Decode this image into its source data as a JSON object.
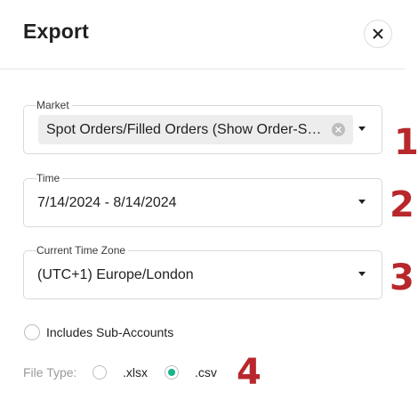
{
  "dialog": {
    "title": "Export",
    "close_icon": "close-icon"
  },
  "market": {
    "label": "Market",
    "selected_chip": "Spot Orders/Filled Orders (Show Order-Specific Details)",
    "chip_display": "Spot Orders/Filled Orders (Show Order-Sp...",
    "marker": "1"
  },
  "time": {
    "label": "Time",
    "value": "7/14/2024 - 8/14/2024",
    "marker": "2"
  },
  "timezone": {
    "label": "Current Time Zone",
    "value": "(UTC+1) Europe/London",
    "marker": "3"
  },
  "sub_accounts": {
    "label": "Includes Sub-Accounts",
    "checked": false
  },
  "file_type": {
    "label": "File Type:",
    "options": [
      {
        "label": ".xlsx",
        "checked": false
      },
      {
        "label": ".csv",
        "checked": true
      }
    ],
    "marker": "4"
  },
  "colors": {
    "accent": "#17b58c",
    "marker": "#b8272b",
    "border": "#d9d9d9"
  }
}
